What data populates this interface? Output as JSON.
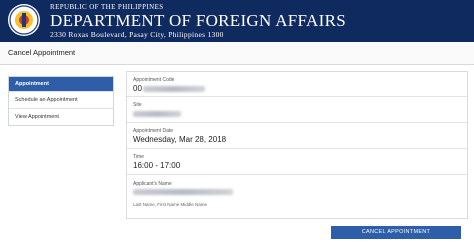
{
  "header": {
    "republic": "REPUBLIC OF THE PHILIPPINES",
    "department": "DEPARTMENT OF FOREIGN AFFAIRS",
    "address": "2330 Roxas Boulevard, Pasay City, Philippines 1300",
    "colors": {
      "banner": "#0f2a5f",
      "text": "#ffffff"
    }
  },
  "page": {
    "title": "Cancel Appointment"
  },
  "nav": {
    "items": [
      {
        "label": "Appointment",
        "active": true
      },
      {
        "label": "Schedule an Appointment",
        "active": false
      },
      {
        "label": "View Appointment",
        "active": false
      }
    ]
  },
  "details": {
    "code_label": "Appointment Code",
    "code_value": "00",
    "site_label": "Site",
    "date_label": "Appointment Date",
    "date_value": "Wednesday, Mar 28, 2018",
    "time_label": "Time",
    "time_value": "16:00 - 17:00",
    "name_label": "Applicant's Name",
    "name_hint": "Last Name, First Name Middle Name"
  },
  "actions": {
    "cancel_label": "CANCEL APPOINTMENT"
  },
  "colors": {
    "accent": "#2f5ea8"
  }
}
